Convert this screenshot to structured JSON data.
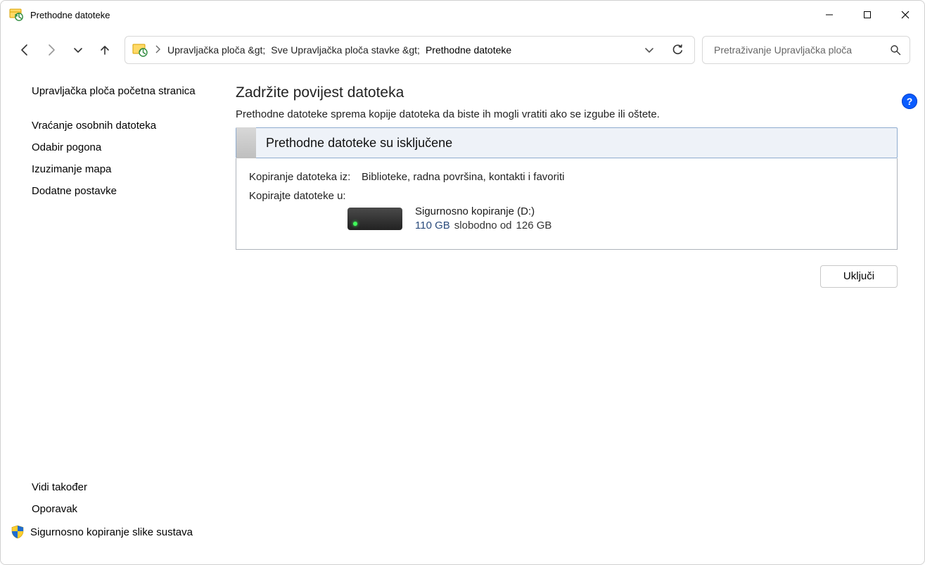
{
  "window": {
    "title": "Prethodne datoteke"
  },
  "breadcrumb": {
    "seg1": "Upravljačka ploča &gt;",
    "seg2": "Sve Upravljačka ploča stavke &gt;",
    "seg3": "Prethodne datoteke"
  },
  "search": {
    "placeholder": "Pretraživanje Upravljačka ploča"
  },
  "help": {
    "symbol": "?"
  },
  "sidebar": {
    "home": "Upravljačka ploča početna stranica",
    "links": [
      "Vraćanje osobnih datoteka",
      "Odabir pogona",
      "Izuzimanje mapa",
      "Dodatne postavke"
    ],
    "seeAlsoHeading": "Vidi također",
    "seeAlso": [
      "Oporavak",
      "Sigurnosno kopiranje slike sustava"
    ]
  },
  "main": {
    "heading": "Zadržite povijest datoteka",
    "subtitle": "Prethodne datoteke sprema kopije datoteka da biste ih mogli vratiti ako se izgube ili oštete.",
    "statusText": "Prethodne datoteke su isključene",
    "copyFromLabel": "Kopiranje datoteka iz:",
    "copyFromValue": "Biblioteke, radna površina, kontakti i favoriti",
    "copyToLabel": "Kopirajte datoteke u:",
    "drive": {
      "name": "Sigurnosno kopiranje (D:)",
      "freeAmount": "110 GB",
      "freeText": "slobodno od",
      "totalAmount": "126 GB"
    },
    "turnOn": "Uključi"
  }
}
